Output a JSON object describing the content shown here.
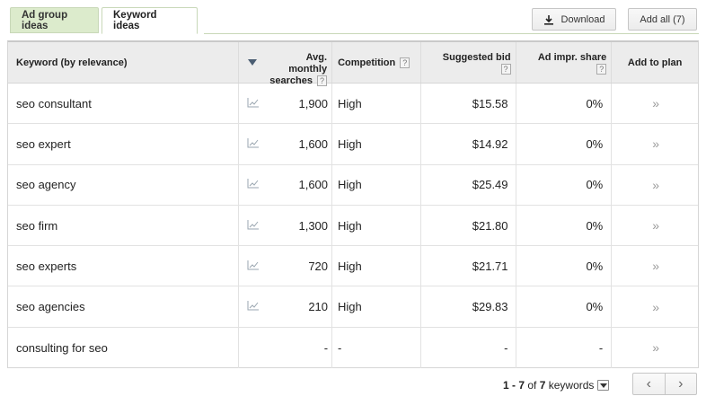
{
  "tabs": [
    {
      "label": "Ad group ideas",
      "active": false
    },
    {
      "label": "Keyword ideas",
      "active": true
    }
  ],
  "toolbar": {
    "download_label": "Download",
    "add_all_label": "Add all (7)"
  },
  "table": {
    "headers": {
      "keyword": "Keyword (by relevance)",
      "avg_monthly_line1": "Avg. monthly",
      "avg_monthly_line2": "searches",
      "competition": "Competition",
      "suggested_bid": "Suggested bid",
      "ad_impr_share": "Ad impr. share",
      "add_to_plan": "Add to plan",
      "help": "?"
    },
    "rows": [
      {
        "keyword": "seo consultant",
        "searches": "1,900",
        "competition": "High",
        "bid": "$15.58",
        "impr": "0%",
        "add": "»"
      },
      {
        "keyword": "seo expert",
        "searches": "1,600",
        "competition": "High",
        "bid": "$14.92",
        "impr": "0%",
        "add": "»"
      },
      {
        "keyword": "seo agency",
        "searches": "1,600",
        "competition": "High",
        "bid": "$25.49",
        "impr": "0%",
        "add": "»"
      },
      {
        "keyword": "seo firm",
        "searches": "1,300",
        "competition": "High",
        "bid": "$21.80",
        "impr": "0%",
        "add": "»"
      },
      {
        "keyword": "seo experts",
        "searches": "720",
        "competition": "High",
        "bid": "$21.71",
        "impr": "0%",
        "add": "»"
      },
      {
        "keyword": "seo agencies",
        "searches": "210",
        "competition": "High",
        "bid": "$29.83",
        "impr": "0%",
        "add": "»"
      },
      {
        "keyword": "consulting for seo",
        "searches": "-",
        "competition": "-",
        "bid": "-",
        "impr": "-",
        "add": "»"
      }
    ]
  },
  "pager": {
    "range": "1 - 7",
    "of": "of",
    "total": "7",
    "unit": "keywords",
    "prev": "‹",
    "next": "›"
  },
  "colors": {
    "tab_inactive": "#dcebcc",
    "header_bg": "#ececec",
    "sort_arrow": "#4a5d72"
  }
}
